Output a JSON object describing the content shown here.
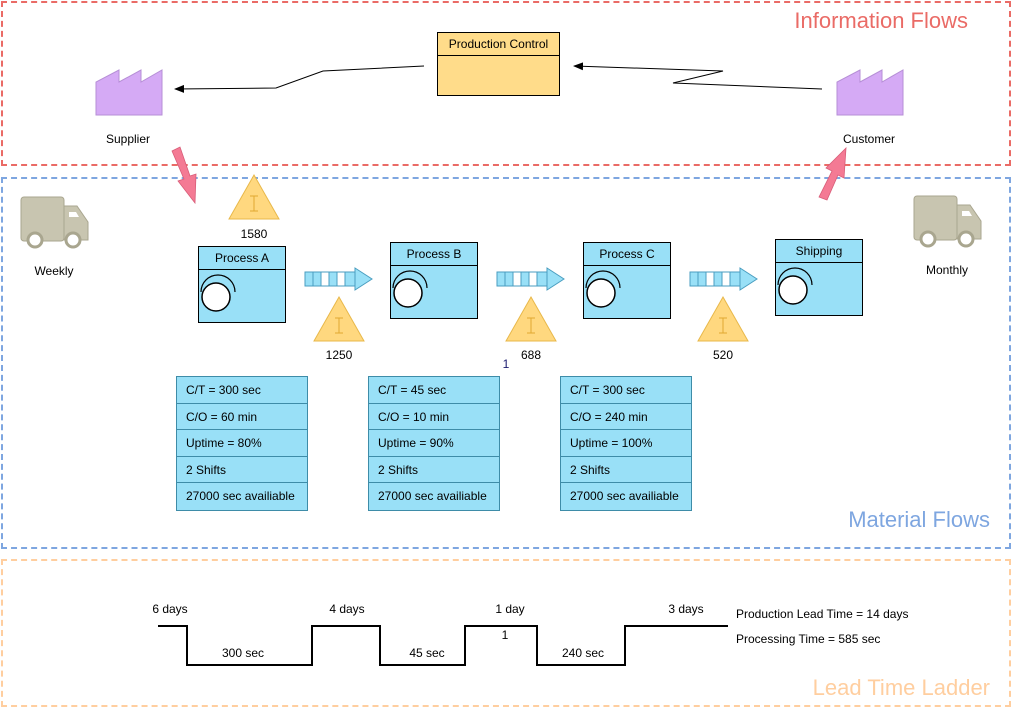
{
  "zones": {
    "information": "Information Flows",
    "material": "Material Flows",
    "lead_time": "Lead Time Ladder"
  },
  "production_control": {
    "label": "Production Control"
  },
  "supplier": {
    "label": "Supplier"
  },
  "customer": {
    "label": "Customer"
  },
  "trucks": {
    "inbound": {
      "label": "Weekly"
    },
    "outbound": {
      "label": "Monthly"
    }
  },
  "inventories": [
    {
      "value": "1580"
    },
    {
      "value": "1250"
    },
    {
      "value": "688"
    },
    {
      "value": "520"
    }
  ],
  "stray_label": "1",
  "processes": [
    {
      "name": "Process A"
    },
    {
      "name": "Process B"
    },
    {
      "name": "Process C"
    },
    {
      "name": "Shipping"
    }
  ],
  "data_boxes": [
    {
      "rows": [
        "C/T = 300 sec",
        "C/O = 60 min",
        "Uptime = 80%",
        "2 Shifts",
        "27000 sec availiable"
      ]
    },
    {
      "rows": [
        "C/T = 45 sec",
        "C/O = 10 min",
        "Uptime = 90%",
        "2 Shifts",
        "27000 sec availiable"
      ]
    },
    {
      "rows": [
        "C/T = 300 sec",
        "C/O = 240 min",
        "Uptime = 100%",
        "2 Shifts",
        "27000 sec availiable"
      ]
    }
  ],
  "ladder": {
    "wait_times": [
      "6 days",
      "4 days",
      "1 day",
      "3 days"
    ],
    "process_times": [
      "300 sec",
      "45 sec",
      "240 sec"
    ],
    "inner_label": "1",
    "production_lead_time": "Production Lead Time = 14 days",
    "processing_time": "Processing Time = 585 sec"
  },
  "colors": {
    "info_border": "#ea6b66",
    "material_border": "#7ea6e0",
    "lead_border": "#ffce9f",
    "process_fill": "#99e0f7",
    "control_fill": "#ffdc8a",
    "factory_fill": "#d5aaf5",
    "inventory_fill": "#ffd87f",
    "truck_fill": "#c8c5b0",
    "shipment_arrow": "#f47a94"
  }
}
